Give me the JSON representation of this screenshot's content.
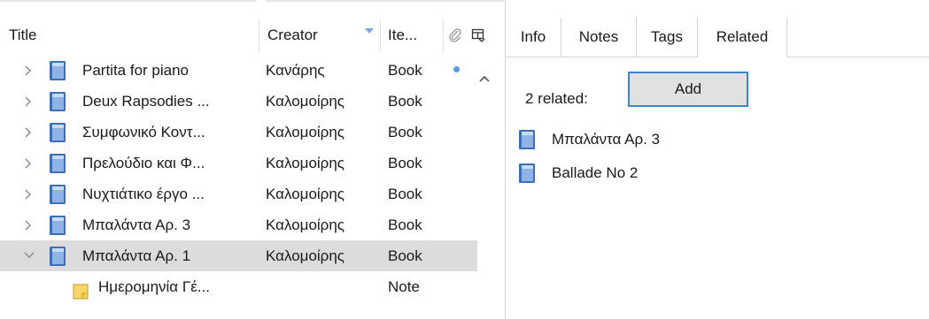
{
  "columns": {
    "title": "Title",
    "creator": "Creator",
    "item_type": "Ite..."
  },
  "rows": [
    {
      "title": "Partita for piano",
      "creator": "Κανάρης",
      "item_type": "Book",
      "kind": "book",
      "expanded": false,
      "selected": false,
      "attachment_dot": true
    },
    {
      "title": "Deux Rapsodies  ...",
      "creator": "Καλομοίρης",
      "item_type": "Book",
      "kind": "book",
      "expanded": false,
      "selected": false
    },
    {
      "title": "Συμφωνικό Κοντ...",
      "creator": "Καλομοίρης",
      "item_type": "Book",
      "kind": "book",
      "expanded": false,
      "selected": false
    },
    {
      "title": "Πρελούδιο και Φ...",
      "creator": "Καλομοίρης",
      "item_type": "Book",
      "kind": "book",
      "expanded": false,
      "selected": false
    },
    {
      "title": "Νυχτιάτικο έργο ...",
      "creator": "Καλομοίρης",
      "item_type": "Book",
      "kind": "book",
      "expanded": false,
      "selected": false
    },
    {
      "title": "Μπαλάντα Αρ. 3",
      "creator": "Καλομοίρης",
      "item_type": "Book",
      "kind": "book",
      "expanded": false,
      "selected": false
    },
    {
      "title": "Μπαλάντα Αρ. 1",
      "creator": "Καλομοίρης",
      "item_type": "Book",
      "kind": "book",
      "expanded": true,
      "selected": true
    },
    {
      "title": "Ημερομηνία Γέ...",
      "creator": "",
      "item_type": "Note",
      "kind": "note",
      "child": true
    }
  ],
  "tabs": [
    {
      "label": "Info"
    },
    {
      "label": "Notes"
    },
    {
      "label": "Tags"
    },
    {
      "label": "Related",
      "active": true
    }
  ],
  "related": {
    "count_label": "2 related:",
    "add_label": "Add",
    "items": [
      {
        "label": "Μπαλάντα Αρ. 3"
      },
      {
        "label": "Ballade No 2"
      }
    ]
  },
  "colors": {
    "accent": "#3b86d4",
    "selected_row": "#dcdcdc",
    "book_icon": "#4f7fc0",
    "note_icon": "#f2c14e"
  }
}
